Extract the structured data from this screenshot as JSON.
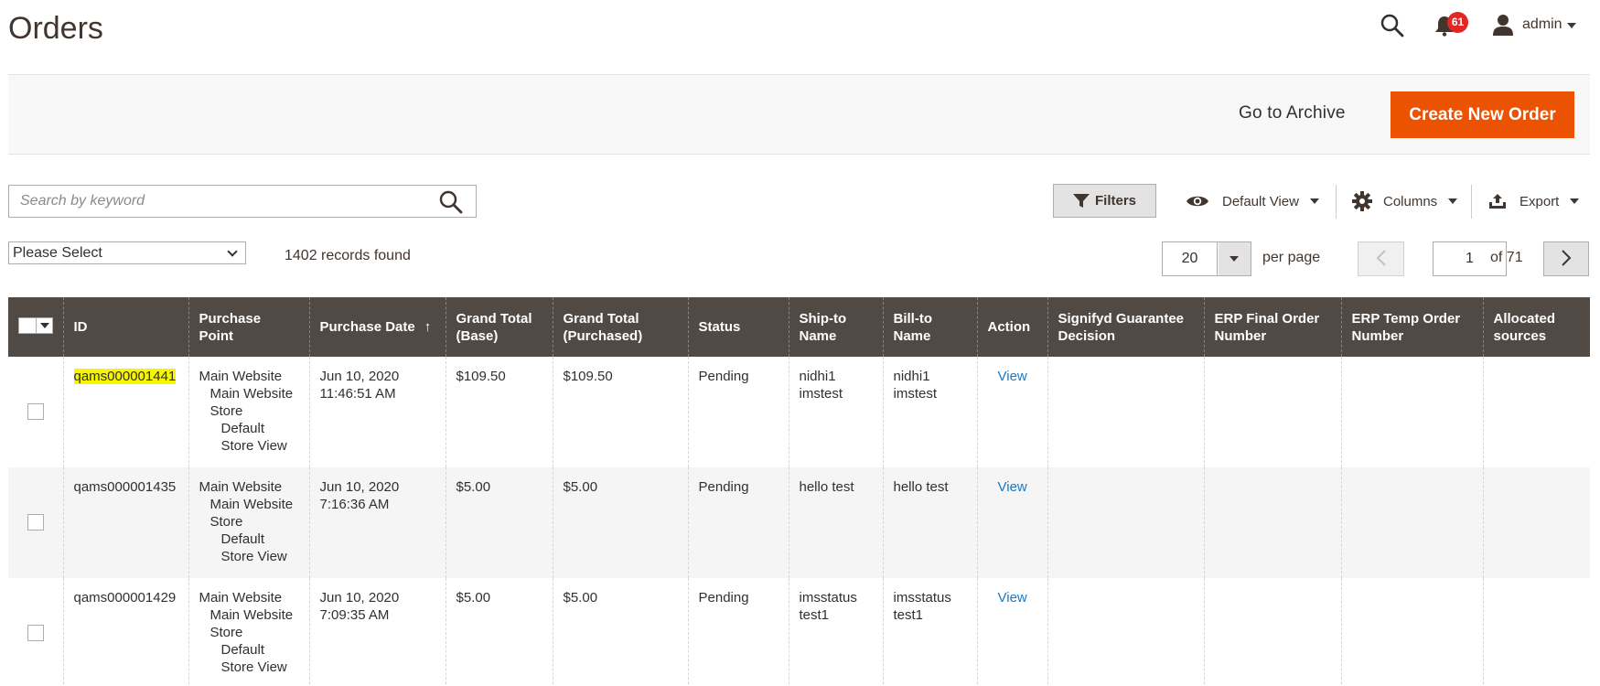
{
  "header": {
    "title": "Orders",
    "notifications_count": "61",
    "user_name": "admin"
  },
  "action_bar": {
    "archive_label": "Go to Archive",
    "create_label": "Create New Order"
  },
  "toolbar": {
    "search_placeholder": "Search by keyword",
    "filters_label": "Filters",
    "view_label": "Default View",
    "columns_label": "Columns",
    "export_label": "Export",
    "mass_action_value": "Please Select",
    "records_found": "1402 records found",
    "per_page_value": "20",
    "per_page_label": "per page",
    "page_value": "1",
    "page_of": "of 71"
  },
  "table": {
    "columns": [
      {
        "label": "ID"
      },
      {
        "label": "Purchase Point"
      },
      {
        "label": "Purchase Date",
        "sort": "↑"
      },
      {
        "label": "Grand Total (Base)"
      },
      {
        "label": "Grand Total (Purchased)"
      },
      {
        "label": "Status"
      },
      {
        "label": "Ship-to Name"
      },
      {
        "label": "Bill-to Name"
      },
      {
        "label": "Action"
      },
      {
        "label": "Signifyd Guarantee Decision"
      },
      {
        "label": "ERP Final Order Number"
      },
      {
        "label": "ERP Temp Order Number"
      },
      {
        "label": "Allocated sources"
      }
    ],
    "rows": [
      {
        "id": "qams000001441",
        "pp_line1": "Main Website",
        "pp_line2": "Main Website Store",
        "pp_line3": "Default Store View",
        "date_line1": "Jun 10, 2020",
        "date_line2": "11:46:51 AM",
        "total_base": "$109.50",
        "total_purchased": "$109.50",
        "status": "Pending",
        "ship_to": "nidhi1 imstest",
        "bill_to": "nidhi1 imstest",
        "action": "View"
      },
      {
        "id": "qams000001435",
        "pp_line1": "Main Website",
        "pp_line2": "Main Website Store",
        "pp_line3": "Default Store View",
        "date_line1": "Jun 10, 2020",
        "date_line2": "7:16:36 AM",
        "total_base": "$5.00",
        "total_purchased": "$5.00",
        "status": "Pending",
        "ship_to": "hello test",
        "bill_to": "hello test",
        "action": "View"
      },
      {
        "id": "qams000001429",
        "pp_line1": "Main Website",
        "pp_line2": "Main Website Store",
        "pp_line3": "Default Store View",
        "date_line1": "Jun 10, 2020",
        "date_line2": "7:09:35 AM",
        "total_base": "$5.00",
        "total_purchased": "$5.00",
        "status": "Pending",
        "ship_to": "imsstatus test1",
        "bill_to": "imsstatus test1",
        "action": "View"
      }
    ]
  },
  "colors": {
    "accent": "#eb5202",
    "header_bg": "#514943",
    "link": "#1979c3",
    "highlight": "#f6f600",
    "badge": "#e22626"
  },
  "icons": [
    "search-icon",
    "bell-icon",
    "user-icon",
    "filter-icon",
    "eye-icon",
    "gear-icon",
    "export-icon",
    "chevron-left-icon",
    "chevron-right-icon"
  ]
}
